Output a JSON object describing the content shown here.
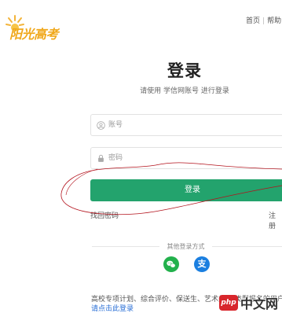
{
  "logo": {
    "text": "阳光高考"
  },
  "topnav": {
    "home": "首页",
    "separator": "|",
    "help": "帮助"
  },
  "login": {
    "title": "登录",
    "subtitle": "请使用 学信网账号 进行登录",
    "username_placeholder": "账号",
    "password_placeholder": "密码",
    "submit_label": "登录",
    "forgot_label": "找回密码",
    "register_label": "注册"
  },
  "other_login": {
    "label": "其他登录方式",
    "wechat_glyph": "",
    "alipay_glyph": "支"
  },
  "notice": {
    "text": "高校专项计划、综合评价、保送生、艺术类 等类型报名的用户",
    "link": "请点击此登录"
  },
  "watermark": {
    "badge": "php",
    "text": "中文网"
  },
  "colors": {
    "brand_green": "#23a36d",
    "logo_orange": "#f0a81c",
    "annotation_red": "#b3121c"
  }
}
